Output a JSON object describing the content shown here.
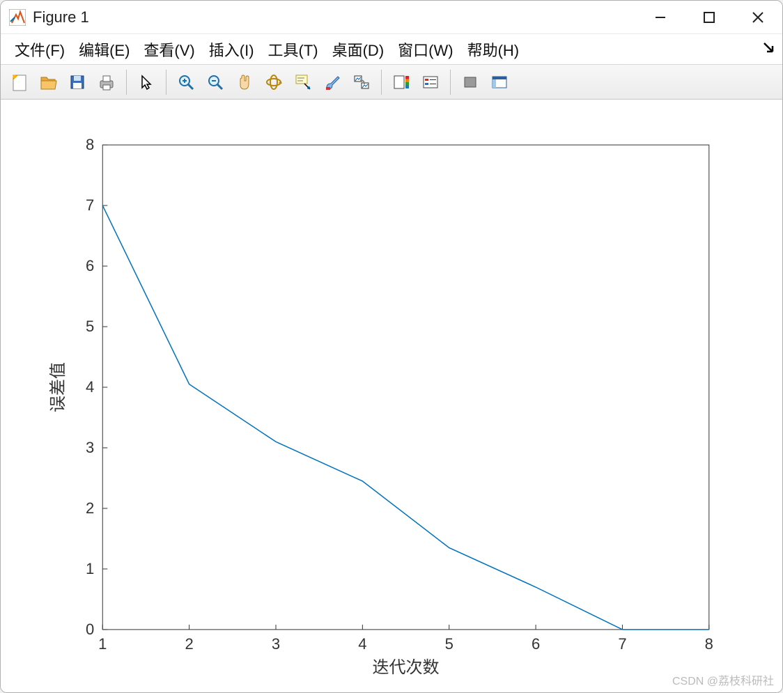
{
  "window": {
    "title": "Figure 1"
  },
  "menu": {
    "file": "文件(F)",
    "edit": "编辑(E)",
    "view": "查看(V)",
    "insert": "插入(I)",
    "tools": "工具(T)",
    "desktop": "桌面(D)",
    "window": "窗口(W)",
    "help": "帮助(H)"
  },
  "toolbar_icons": {
    "new": "new-figure",
    "open": "open",
    "save": "save",
    "print": "print",
    "pointer": "pointer",
    "zoom_in": "zoom-in",
    "zoom_out": "zoom-out",
    "pan": "pan",
    "rotate": "rotate-3d",
    "data_cursor": "data-cursor",
    "brush": "brush",
    "link": "link-plots",
    "colorbar": "colorbar",
    "legend": "legend",
    "hide": "hide-tools",
    "dock": "dock"
  },
  "chart_data": {
    "type": "line",
    "x": [
      1,
      2,
      3,
      4,
      5,
      6,
      7,
      8
    ],
    "y": [
      7.0,
      4.05,
      3.1,
      2.45,
      1.35,
      0.7,
      0.0,
      0.0
    ],
    "xlabel": "迭代次数",
    "ylabel": "误差值",
    "xlim": [
      1,
      8
    ],
    "ylim": [
      0,
      8
    ],
    "xticks": [
      1,
      2,
      3,
      4,
      5,
      6,
      7,
      8
    ],
    "yticks": [
      0,
      1,
      2,
      3,
      4,
      5,
      6,
      7,
      8
    ],
    "line_color": "#0072bd"
  },
  "watermark": "CSDN @荔枝科研社"
}
